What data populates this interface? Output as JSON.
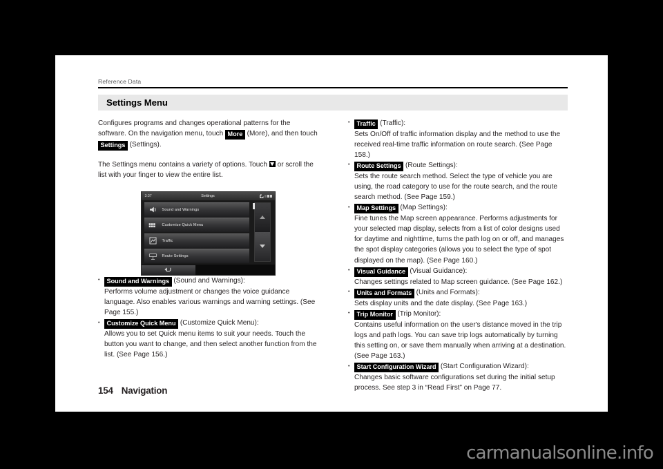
{
  "running_head": "Reference Data",
  "section": {
    "title": "Settings Menu"
  },
  "intro": {
    "p1_a": "Configures programs and changes operational patterns for the software. On the navigation menu, touch ",
    "p1_key1": "More",
    "p1_b": " (More), and then touch ",
    "p1_key2": "Settings",
    "p1_c": " (Settings).",
    "p2_a": "The Settings menu contains a variety of options. Touch ",
    "p2_b": " or scroll the list with your finger to view the entire list."
  },
  "navshot": {
    "clock": "3:37",
    "title": "Settings",
    "rows": [
      {
        "label": "Sound and Warnings",
        "icon": "speaker-icon"
      },
      {
        "label": "Customize Quick Menu",
        "icon": "grid-icon"
      },
      {
        "label": "Traffic",
        "icon": "traffic-icon"
      },
      {
        "label": "Route Settings",
        "icon": "route-icon"
      }
    ],
    "back_icon": "back-arrow-icon",
    "scroll_up_icon": "scroll-up-icon",
    "scroll_down_icon": "scroll-down-icon",
    "satellite_icon": "satellite-icon",
    "battery_icon": "battery-icon"
  },
  "left_bullets": [
    {
      "key": "Sound and Warnings",
      "paren": " (Sound and Warnings):",
      "desc": "Performs volume adjustment or changes the voice guidance language. Also enables various warnings and warning settings. (See Page 155.)"
    },
    {
      "key": "Customize Quick Menu",
      "paren": " (Customize Quick Menu):",
      "desc": "Allows you to set Quick menu items to suit your needs. Touch the button you want to change, and then select another function from the list. (See Page 156.)"
    }
  ],
  "right_bullets": [
    {
      "key": "Traffic",
      "paren": " (Traffic):",
      "desc": "Sets On/Off of traffic information display and the method to use the received real-time traffic information on route search. (See Page 158.)"
    },
    {
      "key": "Route Settings",
      "paren": " (Route Settings):",
      "desc": "Sets the route search method. Select the type of vehicle you are using, the road category to use for the route search, and the route search method. (See Page 159.)"
    },
    {
      "key": "Map Settings",
      "paren": " (Map Settings):",
      "desc": "Fine tunes the Map screen appearance. Performs adjustments for your selected map display, selects from a list of color designs used for daytime and nighttime, turns the path log on or off, and manages the spot display categories (allows you to select the type of spot displayed on the map). (See Page 160.)"
    },
    {
      "key": "Visual Guidance",
      "paren": " (Visual Guidance):",
      "desc": "Changes settings related to Map screen guidance. (See Page 162.)"
    },
    {
      "key": "Units and Formats",
      "paren": " (Units and Formats):",
      "desc": "Sets display units and the date display. (See Page 163.)"
    },
    {
      "key": "Trip Monitor",
      "paren": " (Trip Monitor):",
      "desc": "Contains useful information on the user's distance moved in the trip logs and path logs. You can save trip logs automatically by turning this setting on, or save them manually when arriving at a destination. (See Page 163.)"
    },
    {
      "key": "Start Configuration Wizard",
      "paren": " (Start Configuration Wizard):",
      "desc": "Changes basic software configurations set during the initial setup process. See step 3 in “Read First” on Page 77."
    }
  ],
  "footer": {
    "page_number": "154",
    "chapter": "Navigation"
  },
  "watermark": "carmanualsonline.info",
  "colors": {
    "page_bg": "#ffffff",
    "outer_bg": "#000000",
    "section_bar_bg": "#e8e8e8",
    "text": "#231f20",
    "running_head": "#58595b",
    "key_bg": "#000000",
    "watermark": "#8b8b8b"
  }
}
